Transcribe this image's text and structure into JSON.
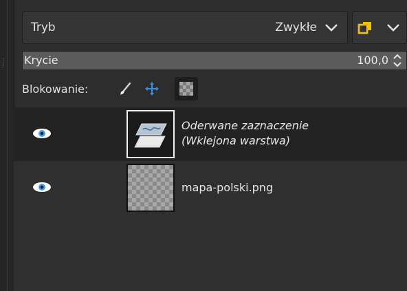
{
  "mode": {
    "label": "Tryb",
    "value": "Zwykłe"
  },
  "opacity": {
    "label": "Krycie",
    "value": "100,0",
    "percent": 100
  },
  "lock": {
    "label": "Blokowanie:",
    "buttons": [
      {
        "name": "lock-pixels-button",
        "icon": "brush-icon"
      },
      {
        "name": "lock-position-button",
        "icon": "move-arrows-icon"
      },
      {
        "name": "lock-alpha-button",
        "icon": "checkerboard-icon",
        "active": true
      }
    ]
  },
  "layers": [
    {
      "name_line1": "Oderwane zaznaczenie",
      "name_line2": "(Wklejona warstwa)",
      "visible": true,
      "selected": true,
      "floating": true
    },
    {
      "name": "mapa-polski.png",
      "visible": true,
      "selected": false,
      "floating": false
    }
  ],
  "colors": {
    "background": "#2d2d2d",
    "selected_row": "#232323",
    "accent_blue": "#3b8fe0",
    "composite_yellow": "#f2c200"
  }
}
